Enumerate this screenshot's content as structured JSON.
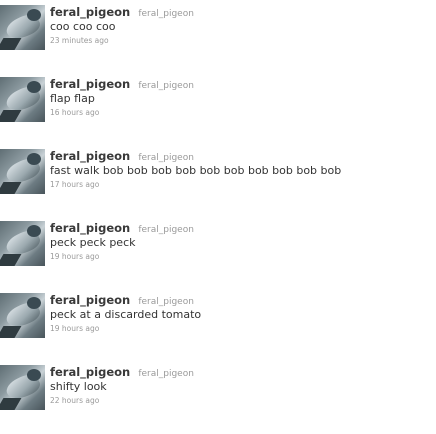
{
  "posts": [
    {
      "display_name": "feral_pigeon",
      "handle": "feral_pigeon",
      "text": "coo coo coo",
      "time": "23 minutes ago"
    },
    {
      "display_name": "feral_pigeon",
      "handle": "feral_pigeon",
      "text": "flap flap",
      "time": "16 hours ago"
    },
    {
      "display_name": "feral_pigeon",
      "handle": "feral_pigeon",
      "text": "fast walk bob bob bob bob bob bob bob bob bob bob",
      "time": "17 hours ago"
    },
    {
      "display_name": "feral_pigeon",
      "handle": "feral_pigeon",
      "text": "peck peck peck",
      "time": "19 hours ago"
    },
    {
      "display_name": "feral_pigeon",
      "handle": "feral_pigeon",
      "text": "peck at a discarded tomato",
      "time": "19 hours ago"
    },
    {
      "display_name": "feral_pigeon",
      "handle": "feral_pigeon",
      "text": "shifty look",
      "time": "22 hours ago"
    }
  ]
}
